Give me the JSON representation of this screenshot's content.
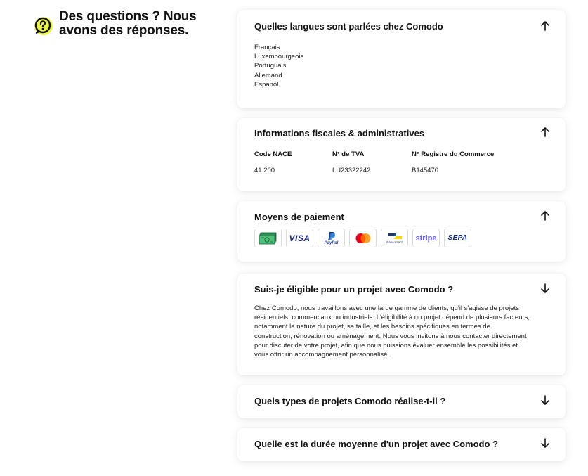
{
  "heading": {
    "line1": "Des questions ? Nous",
    "line2": "avons des réponses."
  },
  "colors": {
    "accent": "#E9F542",
    "text": "#111111"
  },
  "faq": {
    "langs": {
      "title": "Quelles langues sont parlées chez Comodo",
      "expanded": true,
      "items": [
        "Français",
        "Luxembourgeois",
        "Portuguais",
        "Allemand",
        "Espanol"
      ]
    },
    "fiscal": {
      "title": "Informations fiscales & administratives",
      "expanded": true,
      "columns": [
        {
          "label": "Code NACE",
          "value": "41.200"
        },
        {
          "label": "N° de TVA",
          "value": "LU23322242"
        },
        {
          "label": "N° Registre du Commerce",
          "value": "B145470"
        }
      ]
    },
    "payment": {
      "title": "Moyens de paiement",
      "expanded": true,
      "methods": [
        {
          "name": "cash-icon",
          "label": ""
        },
        {
          "name": "visa-logo",
          "label": "VISA"
        },
        {
          "name": "paypal-logo",
          "label": "PayPal"
        },
        {
          "name": "mastercard-logo",
          "label": ""
        },
        {
          "name": "bancontact-logo",
          "label": "Bancontact"
        },
        {
          "name": "stripe-logo",
          "label": "stripe"
        },
        {
          "name": "sepa-logo",
          "label": "SEPA"
        }
      ]
    },
    "eligible": {
      "title": "Suis-je éligible pour un projet avec Comodo ?",
      "expanded": true,
      "lines": [
        "Chez Comodo, nous travaillons avec une large gamme de clients, qu'il s'agisse de projets",
        "résidentiels, commerciaux ou industriels. L'éligibilité à un projet dépend de plusieurs facteurs,",
        "notamment la nature du projet, sa taille, et les besoins spécifiques en termes de",
        "construction, rénovation ou aménagement. Nous vous invitons à nous contacter directement",
        "pour discuter de votre projet, afin que nous puissions évaluer ensemble les possibilités et",
        "vous offrir un accompagnement personnalisé."
      ]
    },
    "types": {
      "title": "Quels types de projets Comodo réalise-t-il ?",
      "expanded": false
    },
    "duration": {
      "title": "Quelle est la durée moyenne d'un projet avec Comodo ?",
      "expanded": false
    }
  }
}
